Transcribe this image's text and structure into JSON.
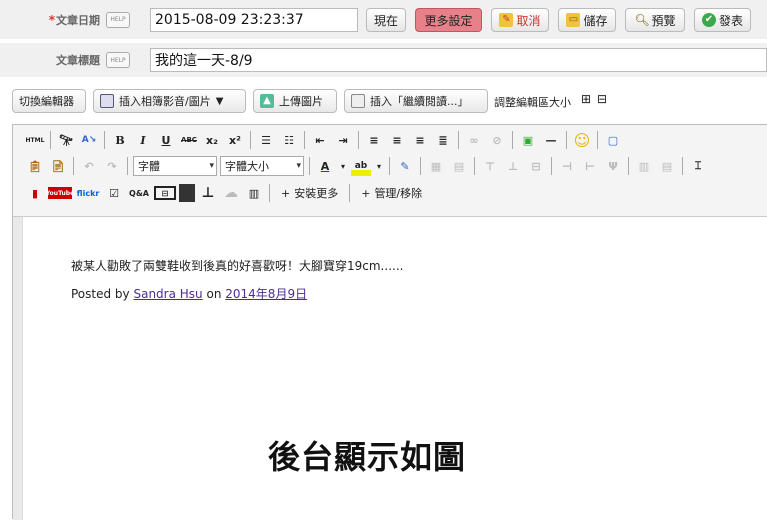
{
  "date_row": {
    "label": "文章日期",
    "required_mark": "*",
    "help": "HELP",
    "value": "2015-08-09 23:23:37",
    "buttons": {
      "now": "現在",
      "more_settings": "更多設定",
      "cancel": "取消",
      "save": "儲存",
      "preview": "預覽",
      "publish": "發表"
    }
  },
  "title_row": {
    "label": "文章標題",
    "help": "HELP",
    "value": "我的這一天-8/9"
  },
  "toolbar": {
    "switch_editor": "切換編輯器",
    "insert_media": "插入相簿影音/圖片",
    "upload_image": "上傳圖片",
    "insert_readmore": "插入「繼續閱讀...」",
    "adjust_size": "調整編輯區大小",
    "plus": "⊞",
    "minus": "⊟"
  },
  "editor_toolbar": {
    "html": "HTML",
    "bold": "B",
    "italic": "I",
    "underline": "U",
    "strike": "ABC",
    "subscript": "x₂",
    "superscript": "x²",
    "font": "字體",
    "font_size": "字體大小",
    "text_color": "A",
    "bg_color": "ab",
    "youtube": "YouTube",
    "flickr": "flickr",
    "qa": "Q&A",
    "install_more": "安裝更多",
    "manage_remove": "管理/移除"
  },
  "content": {
    "paragraph": "被某人勸敗了兩雙鞋收到後真的好喜歡呀！大腳寶穿19cm......",
    "posted_by": "Posted by",
    "author": "Sandra Hsu",
    "on": "on",
    "date": "2014年8月9日",
    "caption": "後台顯示如圖"
  },
  "colors": {
    "pink_button": "#e8808a",
    "link": "#4b2c9c",
    "required": "#dd3333"
  }
}
